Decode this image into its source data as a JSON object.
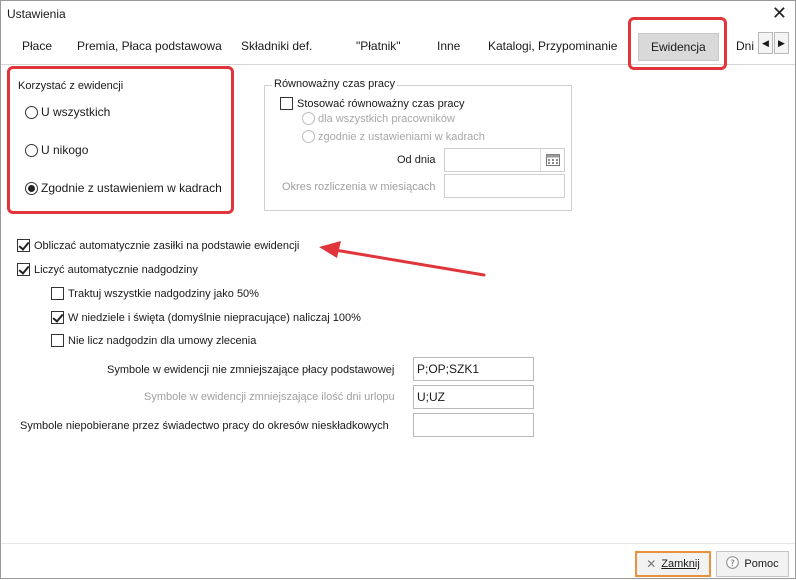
{
  "window": {
    "title": "Ustawienia"
  },
  "tabs": [
    {
      "label": "Płace"
    },
    {
      "label": "Premia, Płaca podstawowa"
    },
    {
      "label": "Składniki def."
    },
    {
      "label": "\"Płatnik\""
    },
    {
      "label": "Inne"
    },
    {
      "label": "Katalogi, Przypominanie"
    },
    {
      "label": "Ewidencja",
      "active": true
    },
    {
      "label": "Dni"
    }
  ],
  "evidence_group": {
    "title": "Korzystać z ewidencji",
    "options": [
      {
        "label": "U wszystkich",
        "selected": false
      },
      {
        "label": "U nikogo",
        "selected": false
      },
      {
        "label": "Zgodnie z ustawieniem w kadrach",
        "selected": true
      }
    ]
  },
  "equivalent_group": {
    "title": "Równoważny czas pracy",
    "checkbox_label": "Stosować równoważny czas pracy",
    "checked": false,
    "options": [
      {
        "label": "dla wszystkich pracowników"
      },
      {
        "label": "zgodnie z ustawieniami w kadrach"
      }
    ],
    "from_date_label": "Od dnia",
    "from_date_value": "",
    "settlement_label": "Okres rozliczenia w miesiącach",
    "settlement_value": ""
  },
  "options": {
    "auto_benefits": {
      "label": "Obliczać automatycznie zasiłki na podstawie ewidencji",
      "checked": true
    },
    "auto_overtime": {
      "label": "Liczyć automatycznie nadgodziny",
      "checked": true
    },
    "overtime_50": {
      "label": "Traktuj wszystkie nadgodziny jako 50%",
      "checked": false
    },
    "sundays_100": {
      "label": "W niedziele i święta (domyślnie niepracujące) naliczaj 100%",
      "checked": true
    },
    "no_overtime_contract": {
      "label": "Nie licz nadgodzin dla umowy zlecenia",
      "checked": false
    }
  },
  "symbols": {
    "not_reducing_label": "Symbole w ewidencji nie zmniejszające płacy podstawowej",
    "not_reducing_value": "P;OP;SZK1",
    "reducing_leave_label": "Symbole w ewidencji zmniejszające ilość dni urlopu",
    "reducing_leave_value": "U;UZ",
    "not_collected_label": "Symbole niepobierane przez świadectwo pracy do okresów nieskładkowych",
    "not_collected_value": ""
  },
  "buttons": {
    "close": "Zamknij",
    "help": "Pomoc"
  },
  "colors": {
    "highlight": "#e0353b",
    "focus_border": "#e8933c"
  }
}
